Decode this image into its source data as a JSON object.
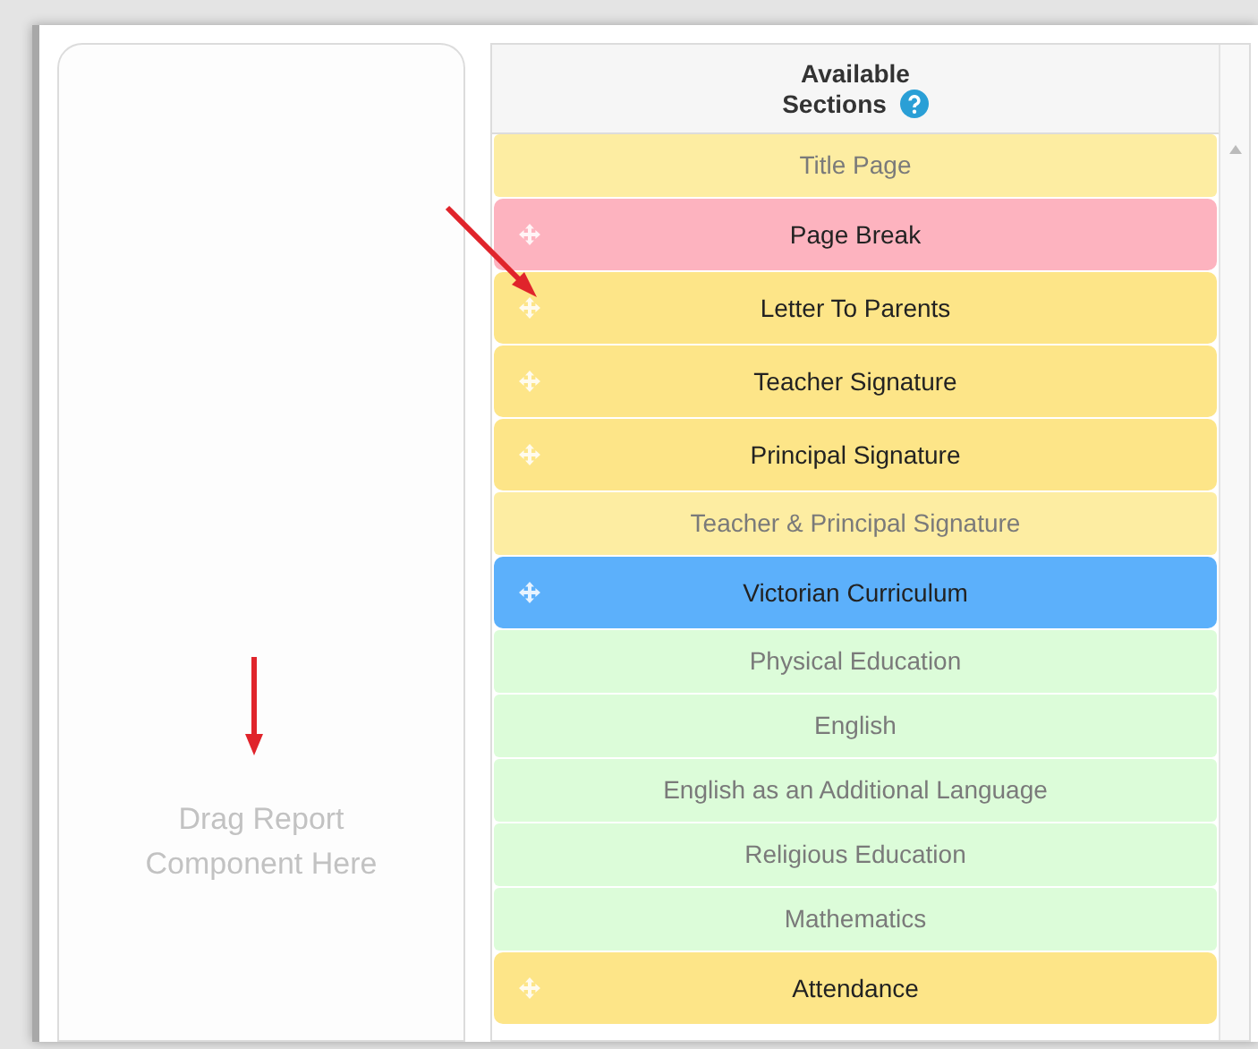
{
  "drop_zone": {
    "placeholder": "Drag Report Component Here"
  },
  "sections_panel": {
    "title": "Available Sections",
    "items": [
      {
        "label": "Title Page",
        "draggable": false,
        "color": "#fdeda2"
      },
      {
        "label": "Page Break",
        "draggable": true,
        "color": "#fdb3bf"
      },
      {
        "label": "Letter To Parents",
        "draggable": true,
        "color": "#fde588"
      },
      {
        "label": "Teacher Signature",
        "draggable": true,
        "color": "#fde588"
      },
      {
        "label": "Principal Signature",
        "draggable": true,
        "color": "#fde588"
      },
      {
        "label": "Teacher & Principal Signature",
        "draggable": false,
        "color": "#fdeda2"
      },
      {
        "label": "Victorian Curriculum",
        "draggable": true,
        "color": "#5cb0fb"
      },
      {
        "label": "Physical Education",
        "draggable": false,
        "color": "#dcfcd9"
      },
      {
        "label": "English",
        "draggable": false,
        "color": "#dcfcd9"
      },
      {
        "label": "English as an Additional Language",
        "draggable": false,
        "color": "#dcfcd9"
      },
      {
        "label": "Religious Education",
        "draggable": false,
        "color": "#dcfcd9"
      },
      {
        "label": "Mathematics",
        "draggable": false,
        "color": "#dcfcd9"
      },
      {
        "label": "Attendance",
        "draggable": true,
        "color": "#fde588"
      }
    ]
  }
}
